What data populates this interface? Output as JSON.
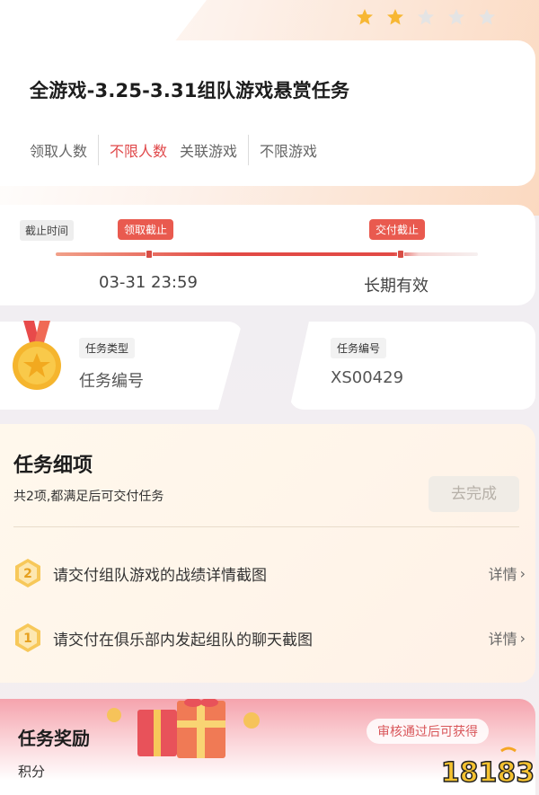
{
  "header": {
    "rating": {
      "filled": 2,
      "total": 5
    },
    "title": "全游戏-3.25-3.31组队游戏悬赏任务",
    "meta": {
      "claim_label": "领取人数",
      "claim_value": "不限人数",
      "game_label": "关联游戏",
      "game_value": "不限游戏"
    }
  },
  "deadline": {
    "label": "截止时间",
    "claim_tag": "领取截止",
    "submit_tag": "交付截止",
    "claim_date": "03-31 23:59",
    "submit_date": "长期有效"
  },
  "info": {
    "type_label": "任务类型",
    "type_value": "任务编号",
    "code_label": "任务编号",
    "code_value": "XS00429"
  },
  "details": {
    "title": "任务细项",
    "subtitle": "共2项,都满足后可交付任务",
    "complete_button": "去完成",
    "items": [
      {
        "number": "2",
        "text": "请交付组队游戏的战绩详情截图",
        "link": "详情"
      },
      {
        "number": "1",
        "text": "请交付在俱乐部内发起组队的聊天截图",
        "link": "详情"
      }
    ]
  },
  "reward": {
    "title": "任务奖励",
    "value": "积分",
    "note": "审核通过后可获得"
  },
  "watermark": {
    "text": "18183"
  },
  "colors": {
    "accent_red": "#e0484a",
    "star_gold": "#f7b733",
    "star_grey": "#e4e4e4"
  }
}
